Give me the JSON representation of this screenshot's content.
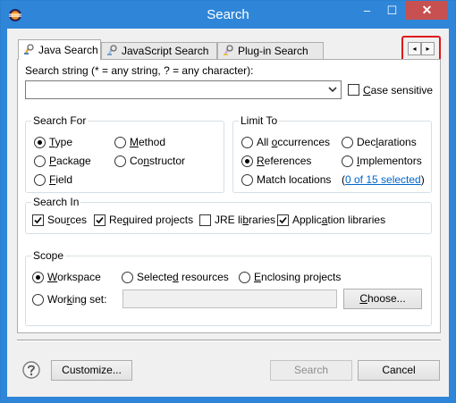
{
  "window": {
    "title": "Search",
    "minimize": "–",
    "maximize": "☐",
    "close": "✕"
  },
  "tabs": [
    {
      "label": "Java Search",
      "active": true
    },
    {
      "label": "JavaScript Search",
      "active": false
    },
    {
      "label": "Plug-in Search",
      "active": false
    }
  ],
  "tab_scroll": {
    "left": "◂",
    "right": "▸"
  },
  "search_string": {
    "label_pre": "Search string (* = any string, ? = any character):",
    "value": "",
    "case_sensitive": {
      "label_pre": "",
      "accel": "C",
      "label_post": "ase sensitive",
      "checked": false
    }
  },
  "search_for": {
    "title": "Search For",
    "options": [
      {
        "pre": "",
        "accel": "T",
        "post": "ype",
        "selected": true
      },
      {
        "pre": "",
        "accel": "M",
        "post": "ethod",
        "selected": false
      },
      {
        "pre": "",
        "accel": "P",
        "post": "ackage",
        "selected": false
      },
      {
        "pre": "Co",
        "accel": "n",
        "post": "structor",
        "selected": false
      },
      {
        "pre": "",
        "accel": "F",
        "post": "ield",
        "selected": false
      }
    ]
  },
  "limit_to": {
    "title": "Limit To",
    "options": [
      {
        "pre": "All ",
        "accel": "o",
        "post": "ccurrences",
        "selected": false
      },
      {
        "pre": "Dec",
        "accel": "l",
        "post": "arations",
        "selected": false
      },
      {
        "pre": "",
        "accel": "R",
        "post": "eferences",
        "selected": true
      },
      {
        "pre": "",
        "accel": "I",
        "post": "mplementors",
        "selected": false
      },
      {
        "pre": "Match locations",
        "accel": "",
        "post": "",
        "selected": false
      }
    ],
    "link_open": "(",
    "link_text": "0 of 15 selected",
    "link_close": ")"
  },
  "search_in": {
    "title": "Search In",
    "options": [
      {
        "pre": "Sou",
        "accel": "r",
        "post": "ces",
        "checked": true
      },
      {
        "pre": "Re",
        "accel": "q",
        "post": "uired projects",
        "checked": true
      },
      {
        "pre": "JRE li",
        "accel": "b",
        "post": "raries",
        "checked": false
      },
      {
        "pre": "Applic",
        "accel": "a",
        "post": "tion libraries",
        "checked": true
      }
    ]
  },
  "scope": {
    "title": "Scope",
    "workspace": {
      "pre": "",
      "accel": "W",
      "post": "orkspace",
      "selected": true
    },
    "selected_resources": {
      "pre": "Selecte",
      "accel": "d",
      "post": " resources",
      "selected": false
    },
    "enclosing_projects": {
      "pre": "",
      "accel": "E",
      "post": "nclosing projects",
      "selected": false
    },
    "working_set": {
      "pre": "Wor",
      "accel": "k",
      "post": "ing set:",
      "selected": false,
      "value": ""
    },
    "choose": {
      "pre": "",
      "accel": "C",
      "post": "hoose..."
    }
  },
  "footer": {
    "customize": "Customize...",
    "search": "Search",
    "cancel": "Cancel"
  }
}
